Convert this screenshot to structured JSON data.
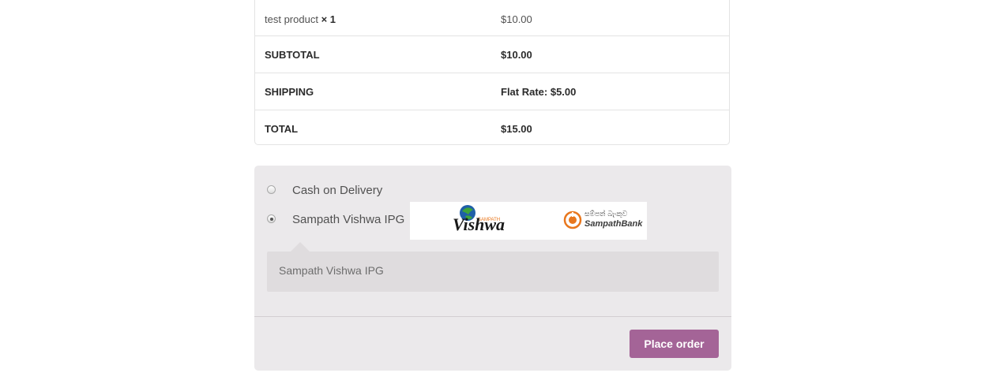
{
  "order": {
    "product_name": "test product",
    "product_qty": "× 1",
    "product_total": "$10.00",
    "subtotal_label": "Subtotal",
    "subtotal_value": "$10.00",
    "shipping_label": "Shipping",
    "shipping_value": "Flat Rate: $5.00",
    "total_label": "Total",
    "total_value": "$15.00"
  },
  "payment": {
    "methods": [
      {
        "label": "Cash on Delivery",
        "selected": false
      },
      {
        "label": "Sampath Vishwa IPG",
        "selected": true
      }
    ],
    "logos": {
      "vishwa_text": "Vishwa",
      "vishwa_small": "SAMPATH",
      "bank_sinhala": "සම්පත් බැංකුව",
      "bank_text": "SampathBank"
    },
    "description": "Sampath Vishwa IPG",
    "place_order_label": "Place order"
  },
  "colors": {
    "accent": "#a46497",
    "panel_bg": "#ebe9eb",
    "desc_bg": "#dfdcde",
    "bank_orange": "#e8771e"
  }
}
